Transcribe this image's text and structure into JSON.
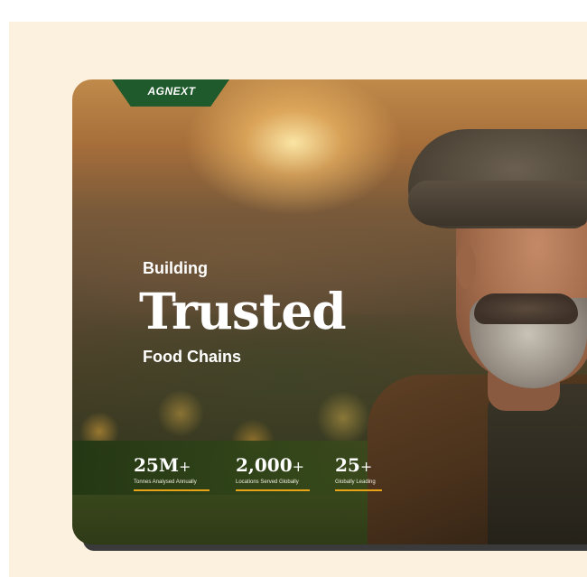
{
  "brand": {
    "logo_text": "AGNEXT"
  },
  "hero": {
    "line1": "Building",
    "line2": "Trusted",
    "line3": "Food Chains"
  },
  "stats": [
    {
      "number": "25M",
      "suffix": "+",
      "label": "Tonnes Analysed Annually"
    },
    {
      "number": "2,000",
      "suffix": "+",
      "label": "Locations Served Globally"
    },
    {
      "number": "25",
      "suffix": "+",
      "label": "Globally Leading"
    }
  ],
  "colors": {
    "background": "#fcf0df",
    "brand_green": "#1f5a2c",
    "accent_bar": "#e8a317",
    "text": "#ffffff"
  }
}
